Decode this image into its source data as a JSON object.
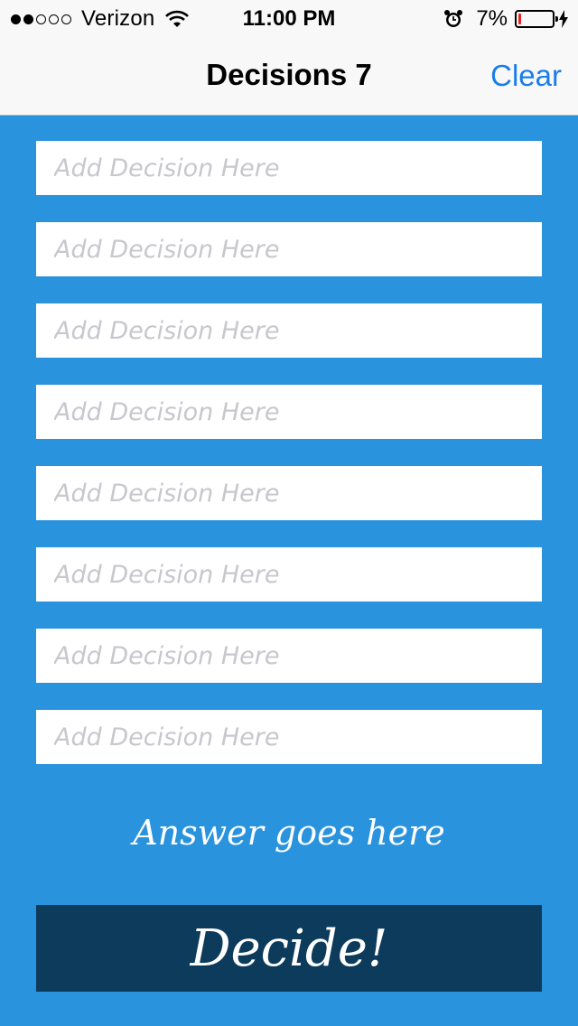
{
  "status_bar": {
    "signal_bars_filled": 2,
    "signal_bars_total": 5,
    "carrier": "Verizon",
    "time": "11:00 PM",
    "battery_percent": "7%",
    "battery_level": 0.07,
    "battery_color": "#e22222"
  },
  "nav": {
    "title": "Decisions 7",
    "clear_label": "Clear",
    "accent_color": "#1a7ee8"
  },
  "decisions": [
    {
      "value": "",
      "placeholder": "Add Decision Here"
    },
    {
      "value": "",
      "placeholder": "Add Decision Here"
    },
    {
      "value": "",
      "placeholder": "Add Decision Here"
    },
    {
      "value": "",
      "placeholder": "Add Decision Here"
    },
    {
      "value": "",
      "placeholder": "Add Decision Here"
    },
    {
      "value": "",
      "placeholder": "Add Decision Here"
    },
    {
      "value": "",
      "placeholder": "Add Decision Here"
    },
    {
      "value": "",
      "placeholder": "Add Decision Here"
    }
  ],
  "answer_text": "Answer goes here",
  "decide_label": "Decide!",
  "colors": {
    "background": "#2a93dd",
    "button": "#0d3b5b"
  },
  "icons": [
    "wifi-icon",
    "alarm-icon",
    "battery-icon",
    "bolt-icon"
  ]
}
